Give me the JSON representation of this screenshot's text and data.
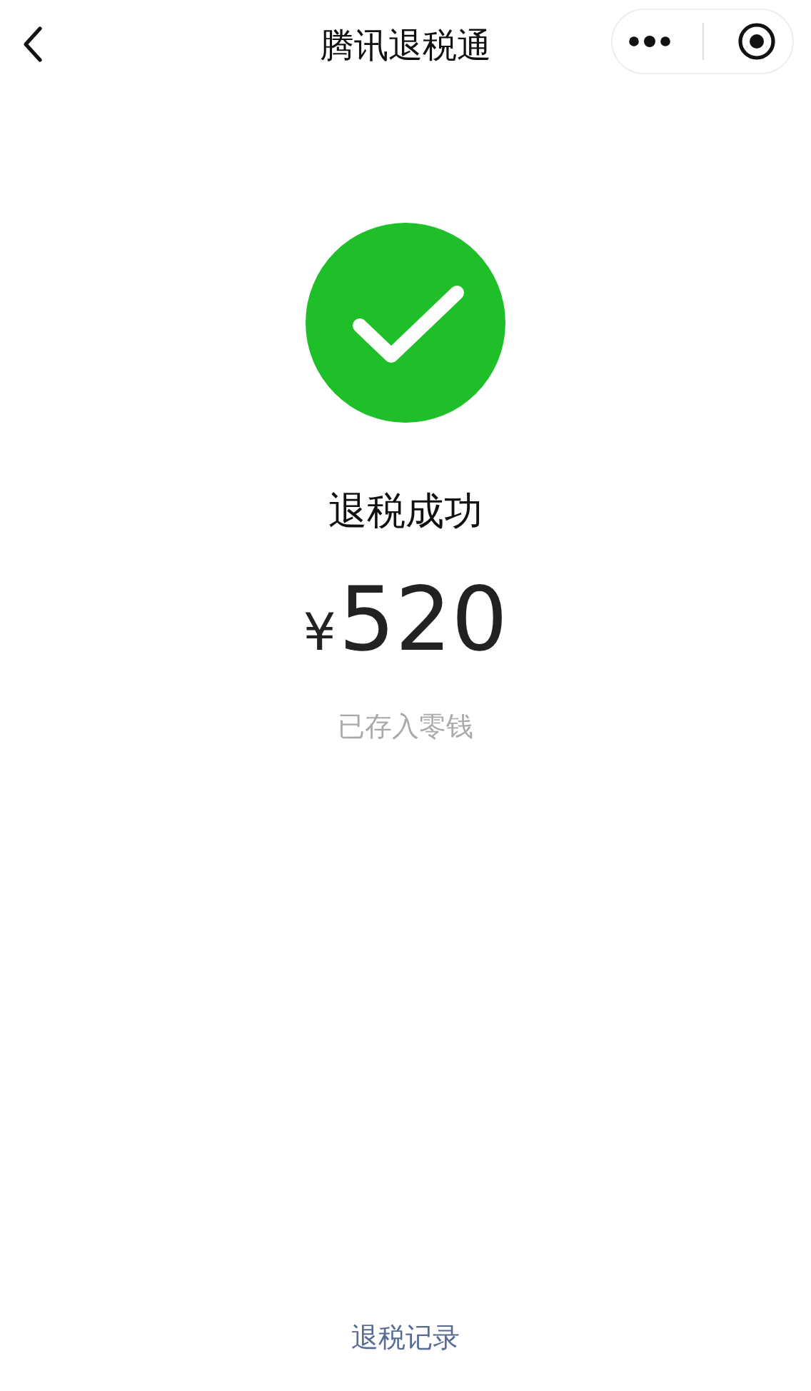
{
  "nav_bar": {
    "title": "腾讯退税通"
  },
  "result": {
    "status": "退税成功",
    "currency": "¥",
    "amount": "520",
    "note": "已存入零钱"
  },
  "footer_link": "退税记录"
}
